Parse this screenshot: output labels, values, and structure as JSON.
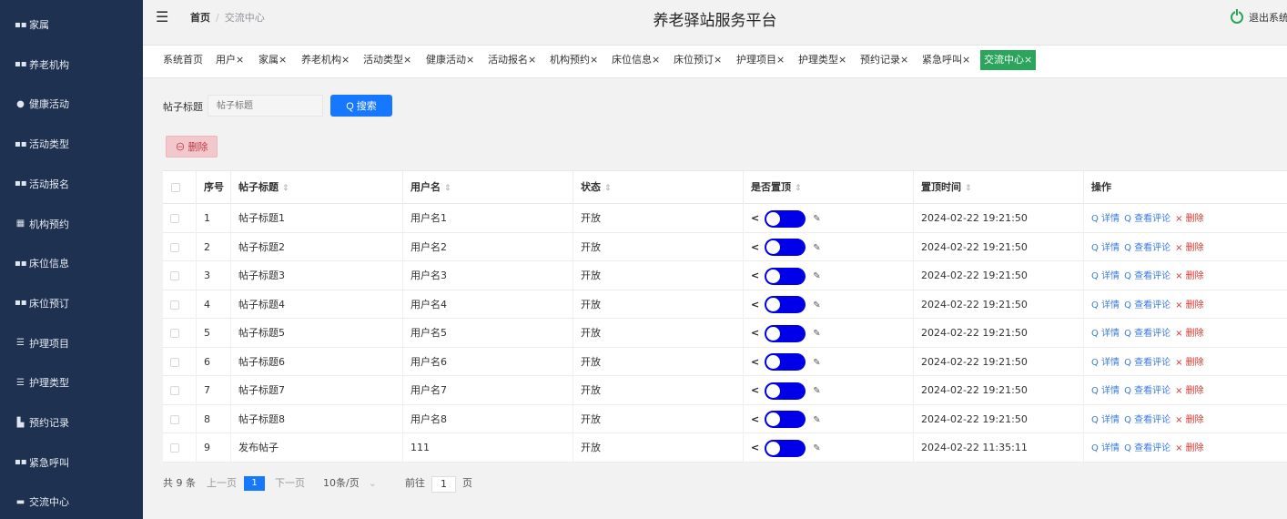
{
  "sidebar": {
    "items": [
      {
        "label": "家属",
        "icon": "grid-icon"
      },
      {
        "label": "养老机构",
        "icon": "grid-icon"
      },
      {
        "label": "健康活动",
        "icon": "map-pin-icon"
      },
      {
        "label": "活动类型",
        "icon": "grid-icon"
      },
      {
        "label": "活动报名",
        "icon": "grid-icon"
      },
      {
        "label": "机构预约",
        "icon": "apps-icon"
      },
      {
        "label": "床位信息",
        "icon": "grid-icon"
      },
      {
        "label": "床位预订",
        "icon": "grid-icon"
      },
      {
        "label": "护理项目",
        "icon": "list-icon"
      },
      {
        "label": "护理类型",
        "icon": "list-icon"
      },
      {
        "label": "预约记录",
        "icon": "thumb-icon"
      },
      {
        "label": "紧急呼叫",
        "icon": "grid-icon"
      },
      {
        "label": "交流中心",
        "icon": "ticket-icon"
      }
    ]
  },
  "header": {
    "breadcrumb_home": "首页",
    "breadcrumb_sep": "/",
    "breadcrumb_current": "交流中心",
    "title": "养老驿站服务平台",
    "logout_label": "退出系统"
  },
  "tags": [
    {
      "label": "系统首页"
    },
    {
      "label": "用户×"
    },
    {
      "label": "家属×"
    },
    {
      "label": "养老机构×"
    },
    {
      "label": "活动类型×"
    },
    {
      "label": "健康活动×"
    },
    {
      "label": "活动报名×"
    },
    {
      "label": "机构预约×"
    },
    {
      "label": "床位信息×"
    },
    {
      "label": "床位预订×"
    },
    {
      "label": "护理项目×"
    },
    {
      "label": "护理类型×"
    },
    {
      "label": "预约记录×"
    },
    {
      "label": "紧急呼叫×"
    },
    {
      "label": "交流中心×",
      "active": true
    }
  ],
  "search": {
    "label": "帖子标题",
    "placeholder": "帖子标题",
    "button_label": "Q 搜索"
  },
  "delete_button": "⊖ 删除",
  "table": {
    "columns": [
      "序号",
      "帖子标题",
      "用户名",
      "状态",
      "是否置顶",
      "置顶时间",
      "操作"
    ],
    "sortable_mark": "⇕",
    "actions": {
      "detail": "Q 详情",
      "comments": "Q 查看评论",
      "delete": "× 删除"
    },
    "rows": [
      {
        "no": "1",
        "title": "帖子标题1",
        "user": "用户名1",
        "status": "开放",
        "time": "2024-02-22 19:21:50"
      },
      {
        "no": "2",
        "title": "帖子标题2",
        "user": "用户名2",
        "status": "开放",
        "time": "2024-02-22 19:21:50"
      },
      {
        "no": "3",
        "title": "帖子标题3",
        "user": "用户名3",
        "status": "开放",
        "time": "2024-02-22 19:21:50"
      },
      {
        "no": "4",
        "title": "帖子标题4",
        "user": "用户名4",
        "status": "开放",
        "time": "2024-02-22 19:21:50"
      },
      {
        "no": "5",
        "title": "帖子标题5",
        "user": "用户名5",
        "status": "开放",
        "time": "2024-02-22 19:21:50"
      },
      {
        "no": "6",
        "title": "帖子标题6",
        "user": "用户名6",
        "status": "开放",
        "time": "2024-02-22 19:21:50"
      },
      {
        "no": "7",
        "title": "帖子标题7",
        "user": "用户名7",
        "status": "开放",
        "time": "2024-02-22 19:21:50"
      },
      {
        "no": "8",
        "title": "帖子标题8",
        "user": "用户名8",
        "status": "开放",
        "time": "2024-02-22 19:21:50"
      },
      {
        "no": "9",
        "title": "发布帖子",
        "user": "111",
        "status": "开放",
        "time": "2024-02-22 11:35:11"
      }
    ]
  },
  "pagination": {
    "total": "共 9 条",
    "prev": "上一页",
    "page": "1",
    "next": "下一页",
    "page_size": "10条/页",
    "goto_prefix": "前往",
    "goto_value": "1",
    "goto_suffix": "页"
  }
}
